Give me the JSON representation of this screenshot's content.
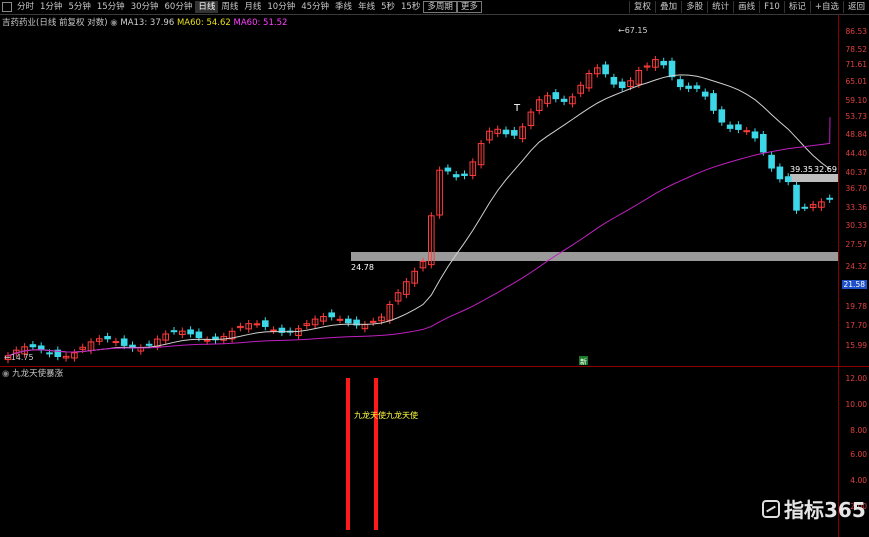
{
  "toolbar": {
    "periods": [
      "分时",
      "1分钟",
      "5分钟",
      "15分钟",
      "30分钟",
      "60分钟",
      "日线",
      "周线",
      "月线",
      "10分钟",
      "45分钟",
      "季线",
      "年线",
      "5秒",
      "15秒",
      "多周期",
      "更多"
    ],
    "active_period": "日线",
    "right_items": [
      "复权",
      "叠加",
      "多股",
      "统计",
      "画线",
      "F10",
      "标记",
      "+自选",
      "返回"
    ]
  },
  "info": {
    "stock": "吉药药业(日线 前复权 对数)",
    "ma13": "MA13: 37.96",
    "ma60": "MA60: 54.62",
    "ma60b": "MA60: 51.52"
  },
  "main_axis": {
    "labels": [
      "86.53",
      "78.52",
      "71.61",
      "65.01",
      "59.10",
      "53.73",
      "48.84",
      "44.40",
      "40.37",
      "36.70",
      "33.36",
      "30.33",
      "27.57",
      "24.32",
      "21.58",
      "19.78",
      "17.70",
      "15.99"
    ],
    "highlight": "21.58"
  },
  "sub_axis": {
    "labels": [
      "12.00",
      "10.00",
      "8.00",
      "6.00",
      "4.00",
      "2.00"
    ]
  },
  "annotations": {
    "high": "67.15",
    "low": "14.75",
    "t_mark": "T",
    "gap_label": "24.78",
    "box_low": "39.35",
    "box_high": "32.69",
    "new_tag": "新"
  },
  "sub": {
    "title": "九龙天使暴涨",
    "signal_text": "九龙天使九龙天使"
  },
  "logo": {
    "text": "指标365"
  },
  "colors": {
    "up": "#ff3c3c",
    "down": "#3cd8e8",
    "ma13": "#d0d0d0",
    "ma60": "#c020c0",
    "axis": "#e04040"
  }
}
